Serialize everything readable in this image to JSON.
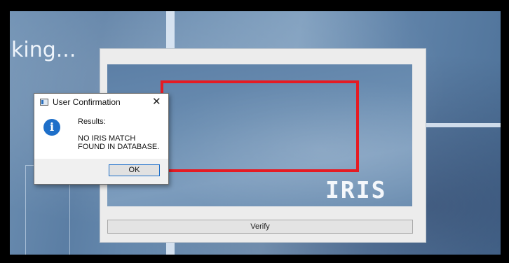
{
  "background": {
    "partial_text": "king..."
  },
  "camera_window": {
    "overlay_label": "IRIS",
    "verify_label": "Verify",
    "box_color": "#e51b23"
  },
  "dialog": {
    "title": "User Confirmation",
    "close_glyph": "✕",
    "icon_glyph": "i",
    "results_label": "Results:",
    "message_line1": "NO IRIS MATCH",
    "message_line2": "FOUND IN DATABASE.",
    "ok_label": "OK"
  }
}
